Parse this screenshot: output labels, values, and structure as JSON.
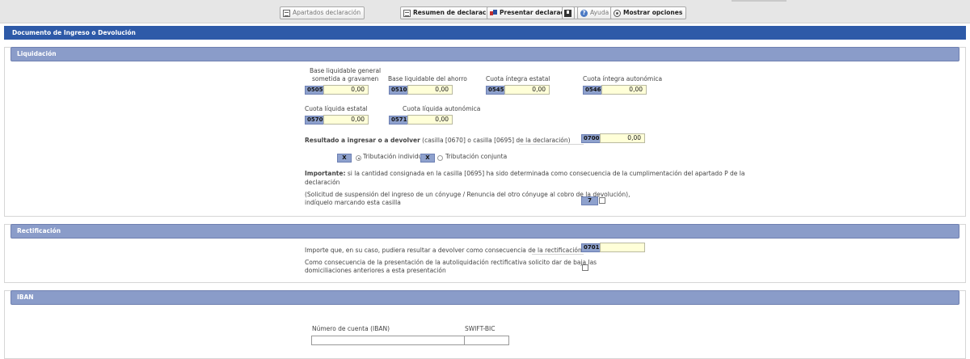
{
  "toolbar": {
    "apartados": "Apartados declaración",
    "resumen": "Resumen de declaraciones",
    "presentar": "Presentar declaración",
    "ayuda": "Ayuda",
    "opciones": "Mostrar opciones"
  },
  "doc_title": "Documento de Ingreso o Devolución",
  "liquidacion": {
    "title": "Liquidación",
    "base_general_l1": "Base liquidable general",
    "base_general_l2": "sometida a gravamen",
    "base_general_code": "0505",
    "base_general_value": "0,00",
    "base_ahorro": "Base liquidable del ahorro",
    "base_ahorro_code": "0510",
    "base_ahorro_value": "0,00",
    "cuota_integra_estatal": "Cuota íntegra estatal",
    "cuota_integra_estatal_code": "0545",
    "cuota_integra_estatal_value": "0,00",
    "cuota_integra_autonomica": "Cuota íntegra autonómica",
    "cuota_integra_autonomica_code": "0546",
    "cuota_integra_autonomica_value": "0,00",
    "cuota_liquida_estatal": "Cuota líquida estatal",
    "cuota_liquida_estatal_code": "0570",
    "cuota_liquida_estatal_value": "0,00",
    "cuota_liquida_autonomica": "Cuota líquida autonómica",
    "cuota_liquida_autonomica_code": "0571",
    "cuota_liquida_autonomica_value": "0,00",
    "resultado_bold": "Resultado a ingresar o a devolver",
    "resultado_rest": " (casilla [0670] o casilla [0695] de la declaración)",
    "resultado_code": "0700",
    "resultado_value": "0,00",
    "x_mark": "X",
    "trib_individual": "Tributación individual",
    "trib_conjunta": "Tributación conjunta",
    "importante_bold": "Importante:",
    "importante_rest": " si la cantidad consignada en la casilla [0695] ha sido determinada como consecuencia de la cumplimentación del apartado P de la",
    "importante_l2": "declaración",
    "solicitud_l1": "(Solicitud de suspensión del ingreso de un cónyuge / Renuncia del otro cónyuge al cobro de la devolución),",
    "solicitud_l2": "indíquelo marcando esta casilla",
    "solicitud_code": "7"
  },
  "rectificacion": {
    "title": "Rectificación",
    "importe": "Importe que, en su caso, pudiera resultar a devolver como consecuencia de la rectificación",
    "importe_code": "0701",
    "baja_l1": "Como consecuencia de la presentación de la autoliquidación rectificativa solicito dar de baja las",
    "baja_l2": "domiciliaciones anteriores a esta presentación"
  },
  "iban": {
    "title": "IBAN",
    "numero_cuenta": "Número de cuenta (IBAN)",
    "swift": "SWIFT-BIC"
  }
}
